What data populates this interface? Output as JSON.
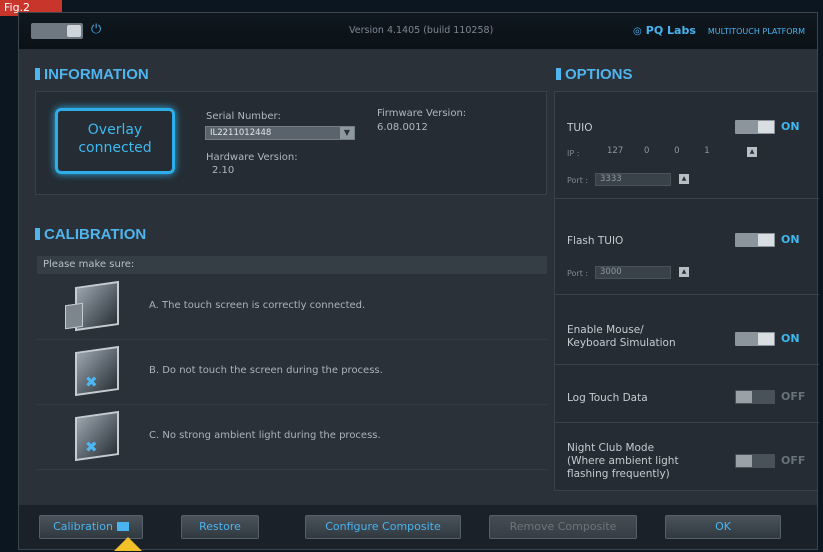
{
  "figure_tag": "Fig.2",
  "titlebar": {
    "version": "Version 4.1405 (build 110258)",
    "brand": "PQ Labs",
    "brand_sub": "MULTITOUCH PLATFORM"
  },
  "information": {
    "title": "INFORMATION",
    "overlay_status": "Overlay connected",
    "serial_label": "Serial Number:",
    "serial_value": "IL2211012448",
    "hardware_label": "Hardware Version:",
    "hardware_value": "2.10",
    "firmware_label": "Firmware Version:",
    "firmware_value": "6.08.0012"
  },
  "calibration": {
    "title": "CALIBRATION",
    "header": "Please make sure:",
    "items": [
      {
        "text": "A. The touch screen is correctly connected."
      },
      {
        "text": "B. Do not touch the screen during the process."
      },
      {
        "text": "C. No strong ambient light during the process."
      }
    ]
  },
  "options": {
    "title": "OPTIONS",
    "tuio": {
      "label": "TUIO",
      "state": "ON",
      "ip_label": "IP :",
      "ip": [
        "127",
        "0",
        "0",
        "1"
      ],
      "port_label": "Port :",
      "port": "3333"
    },
    "flash_tuio": {
      "label": "Flash TUIO",
      "state": "ON",
      "port_label": "Port :",
      "port": "3000"
    },
    "mouse_sim": {
      "label_line1": "Enable Mouse/",
      "label_line2": "Keyboard Simulation",
      "state": "ON"
    },
    "log_touch": {
      "label": "Log Touch Data",
      "state": "OFF"
    },
    "night_club": {
      "label_line1": "Night Club Mode",
      "label_line2": "(Where ambient light",
      "label_line3": "flashing frequently)",
      "state": "OFF"
    }
  },
  "buttons": {
    "calibration": "Calibration",
    "restore": "Restore",
    "configure_composite": "Configure Composite",
    "remove_composite": "Remove Composite",
    "ok": "OK"
  },
  "colors": {
    "accent": "#4fb5ee",
    "background": "#2a3138",
    "highlight_arrow": "#f2c128"
  }
}
